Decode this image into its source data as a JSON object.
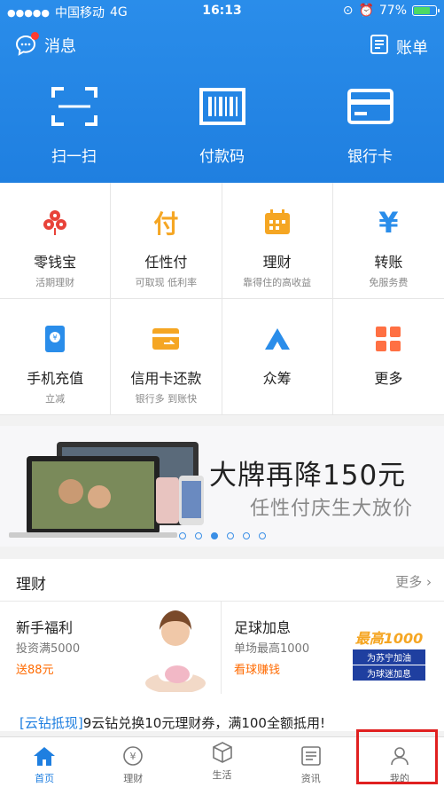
{
  "status": {
    "carrier": "中国移动",
    "network": "4G",
    "time": "16:13",
    "battery": "77%",
    "battery_level": 0.77
  },
  "topbar": {
    "messages_label": "消息",
    "bill_label": "账单"
  },
  "quick_actions": [
    {
      "label": "扫一扫",
      "icon": "scan-icon"
    },
    {
      "label": "付款码",
      "icon": "barcode-icon"
    },
    {
      "label": "银行卡",
      "icon": "bank-card-icon"
    }
  ],
  "grid": [
    {
      "label": "零钱宝",
      "sub": "活期理财",
      "icon": "coin-flower-icon",
      "color": "#e8433a"
    },
    {
      "label": "任性付",
      "sub": "可取现 低利率",
      "icon": "fu-char-icon",
      "color": "#f5a623"
    },
    {
      "label": "理财",
      "sub": "靠得住的高收益",
      "icon": "finance-icon",
      "color": "#f5a623"
    },
    {
      "label": "转账",
      "sub": "免服务费",
      "icon": "yen-icon",
      "color": "#2a8dea"
    },
    {
      "label": "手机充值",
      "sub": "立减",
      "icon": "phone-recharge-icon",
      "color": "#2a8dea"
    },
    {
      "label": "信用卡还款",
      "sub": "银行多 到账快",
      "icon": "credit-card-icon",
      "color": "#f5a623"
    },
    {
      "label": "众筹",
      "sub": "",
      "icon": "crowdfunding-icon",
      "color": "#2a8dea"
    },
    {
      "label": "更多",
      "sub": "",
      "icon": "more-grid-icon",
      "color": "#ff7043"
    }
  ],
  "banner": {
    "title": "大牌再降150元",
    "subtitle": "任性付庆生大放价",
    "slides": 6,
    "active_slide": 3
  },
  "finance": {
    "title": "理财",
    "more_label": "更多",
    "cards": [
      {
        "title": "新手福利",
        "subtitle": "投资满5000",
        "highlight": "送88元"
      },
      {
        "title": "足球加息",
        "subtitle": "单场最高1000",
        "highlight": "看球赚钱"
      }
    ],
    "promo_tag": "[云钻抵现]",
    "promo_text": "9云钻兑换10元理财券，满100全额抵用!",
    "promo_badge_lines": [
      "最高1000",
      "为苏宁加油",
      "为球迷加息"
    ]
  },
  "tabs": [
    {
      "label": "首页",
      "icon": "home-icon",
      "active": true
    },
    {
      "label": "理财",
      "icon": "yen-circle-icon",
      "active": false
    },
    {
      "label": "生活",
      "icon": "box-icon",
      "active": false
    },
    {
      "label": "资讯",
      "icon": "news-icon",
      "active": false
    },
    {
      "label": "我的",
      "icon": "person-icon",
      "active": false
    }
  ],
  "colors": {
    "primary": "#1f7fe0",
    "accent_orange": "#ff6a00",
    "highlight_box": "#e02020"
  }
}
